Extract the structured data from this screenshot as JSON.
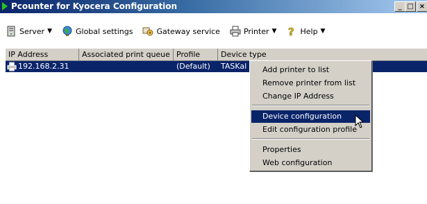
{
  "window": {
    "title": "Pcounter for Kyocera Configuration",
    "caption_buttons": {
      "minimize": "_",
      "maximize": "□",
      "close": "×"
    }
  },
  "toolbar": {
    "items": [
      {
        "label": "Server",
        "icon": "server-icon",
        "dropdown": true
      },
      {
        "label": "Global settings",
        "icon": "globe-icon",
        "dropdown": false
      },
      {
        "label": "Gateway service",
        "icon": "gateway-icon",
        "dropdown": false
      },
      {
        "label": "Printer",
        "icon": "printer-icon",
        "dropdown": true
      },
      {
        "label": "Help",
        "icon": "help-icon",
        "dropdown": true
      }
    ]
  },
  "listview": {
    "columns": [
      "IP Address",
      "Associated print queue",
      "Profile",
      "Device type"
    ],
    "rows": [
      {
        "ip": "192.168.2.31",
        "queue": "",
        "profile": "(Default)",
        "device_type": "TASKal"
      }
    ]
  },
  "context_menu": {
    "items": [
      "Add printer to list",
      "Remove printer from list",
      "Change IP Address",
      "Device configuration",
      "Edit configuration profile",
      "Properties",
      "Web configuration"
    ],
    "highlighted": "Device configuration"
  },
  "colors": {
    "selection": "#0a246a",
    "face": "#d4d0c8",
    "title_start": "#0a246a",
    "title_end": "#a6caf0"
  }
}
